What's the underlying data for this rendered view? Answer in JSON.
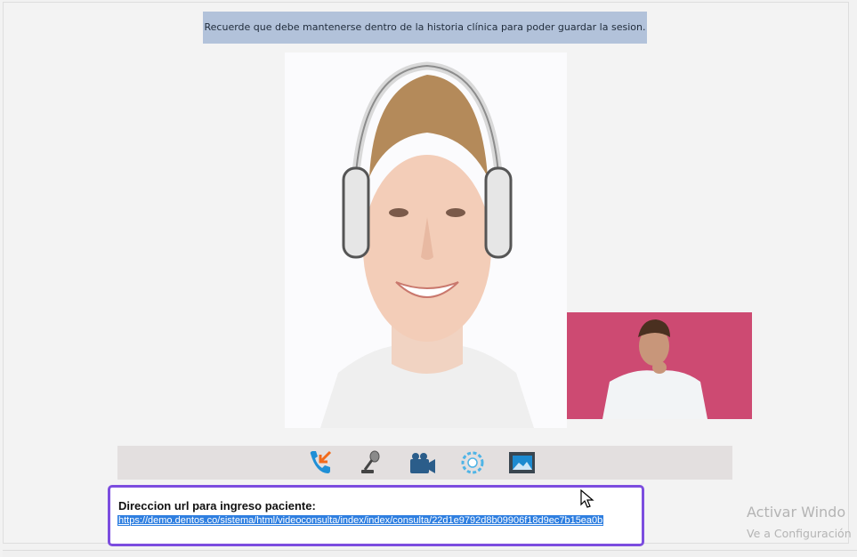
{
  "notice": {
    "text": "Recuerde que debe mantenerse dentro de la historia clínica para poder guardar la sesion."
  },
  "videos": {
    "remote_description": "remote-video",
    "local_description": "local-video"
  },
  "toolbar": {
    "buttons": [
      {
        "icon": "phone-hangup-icon"
      },
      {
        "icon": "microphone-icon"
      },
      {
        "icon": "video-camera-icon"
      },
      {
        "icon": "settings-gear-icon"
      },
      {
        "icon": "image-gallery-icon"
      }
    ]
  },
  "patient_url": {
    "label": "Direccion url para ingreso paciente:",
    "url": "https://demo.dentos.co/sistema/html/videoconsulta/index/index/consulta/22d1e9792d8b09906f18d9ec7b15ea0b"
  },
  "windows_watermark": {
    "title": "Activar Windo",
    "subtitle": "Ve a Configuración"
  },
  "colors": {
    "notice_bg": "#b2c2da",
    "toolbar_bg": "#e3dfdf",
    "url_border": "#7c4ddf",
    "link_highlight": "#2f7fe0",
    "pip_bg": "#cd4a72",
    "icon_blue": "#1f8fd6",
    "icon_orange": "#f26a1b"
  }
}
